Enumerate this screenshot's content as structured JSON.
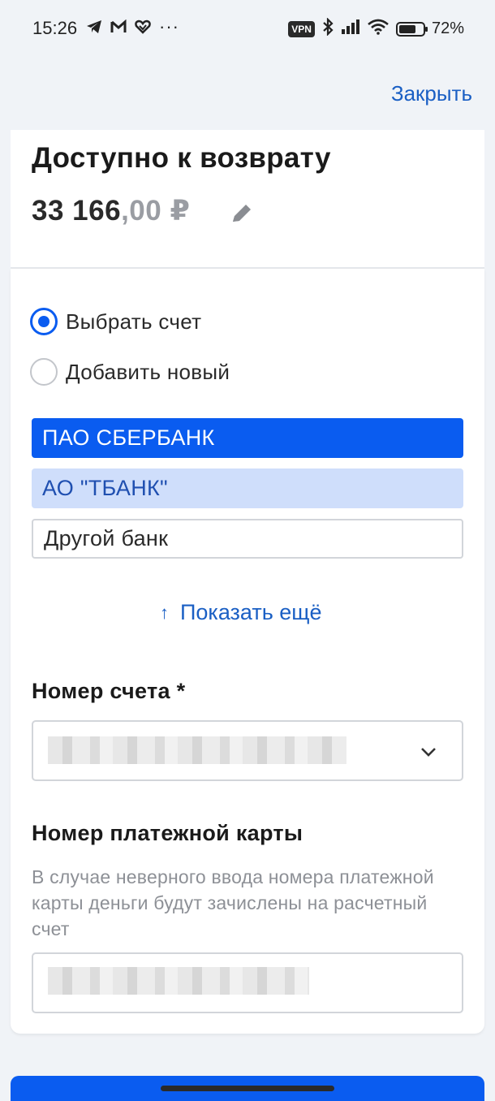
{
  "status_bar": {
    "time": "15:26",
    "left_icons": [
      "telegram-icon",
      "gmail-icon",
      "app-heart-icon"
    ],
    "more_indicator": "···",
    "vpn_label": "VPN",
    "battery_level": 0.72,
    "battery_percent": "72%"
  },
  "header": {
    "close_label": "Закрыть"
  },
  "refund": {
    "title": "Доступно к возврату",
    "amount_int": "33 166",
    "amount_dec": ",00 ₽"
  },
  "account_choice": {
    "options": [
      {
        "label": "Выбрать счет",
        "checked": true
      },
      {
        "label": "Добавить новый",
        "checked": false
      }
    ]
  },
  "banks": [
    {
      "label": "ПАО СБЕРБАНК",
      "state": "selected"
    },
    {
      "label": "АО \"ТБАНК\"",
      "state": "hover"
    },
    {
      "label": "Другой банк",
      "state": "default"
    }
  ],
  "show_more": {
    "label": "Показать ещё"
  },
  "account_number": {
    "label": "Номер счета *"
  },
  "card_number": {
    "label": "Номер платежной карты",
    "hint": "В случае неверного ввода номера платежной карты деньги будут зачислены на расчетный счет"
  },
  "colors": {
    "accent": "#0a5cf0",
    "link": "#1a5fc4",
    "background": "#f0f3f7"
  }
}
